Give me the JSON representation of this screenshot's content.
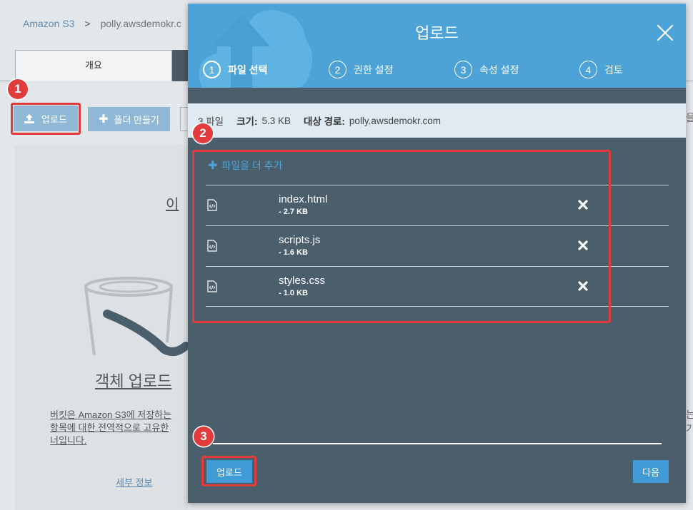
{
  "background": {
    "breadcrumb": {
      "root": "Amazon S3",
      "separator": ">",
      "bucket": "polly.awsdemokr.c"
    },
    "tab_overview": "개요",
    "upload_button": "업로드",
    "create_folder_button": "폴더 만들기",
    "panel_title": "이",
    "object_upload_title": "객체 업로드",
    "description_lines": [
      "버킷은 Amazon S3에 저장하는",
      "항목에 대한 전역적으로 고유한",
      "너입니다."
    ],
    "more_info": "세부 정보",
    "right_glyphs": [
      "을",
      "는",
      "기"
    ]
  },
  "modal": {
    "title": "업로드",
    "steps": [
      {
        "num": "1",
        "label": "파일 선택",
        "active": true
      },
      {
        "num": "2",
        "label": "권한 설정",
        "active": false
      },
      {
        "num": "3",
        "label": "속성 설정",
        "active": false
      },
      {
        "num": "4",
        "label": "검토",
        "active": false
      }
    ],
    "summary": {
      "file_count": "3 파일",
      "size_label": "크기:",
      "size_value": "5.3 KB",
      "dest_label": "대상 경로:",
      "dest_value": "polly.awsdemokr.com"
    },
    "add_more": "파일을 더 추가",
    "files": [
      {
        "name": "index.html",
        "size": "- 2.7 KB"
      },
      {
        "name": "scripts.js",
        "size": "- 1.6 KB"
      },
      {
        "name": "styles.css",
        "size": "- 1.0 KB"
      }
    ],
    "upload_button": "업로드",
    "next_button": "다음"
  },
  "callouts": [
    "1",
    "2",
    "3"
  ],
  "colors": {
    "modal_header": "#4da3d8",
    "modal_body": "#4b5e6c",
    "button": "#3f9ad6",
    "callout": "#e23b3b"
  }
}
